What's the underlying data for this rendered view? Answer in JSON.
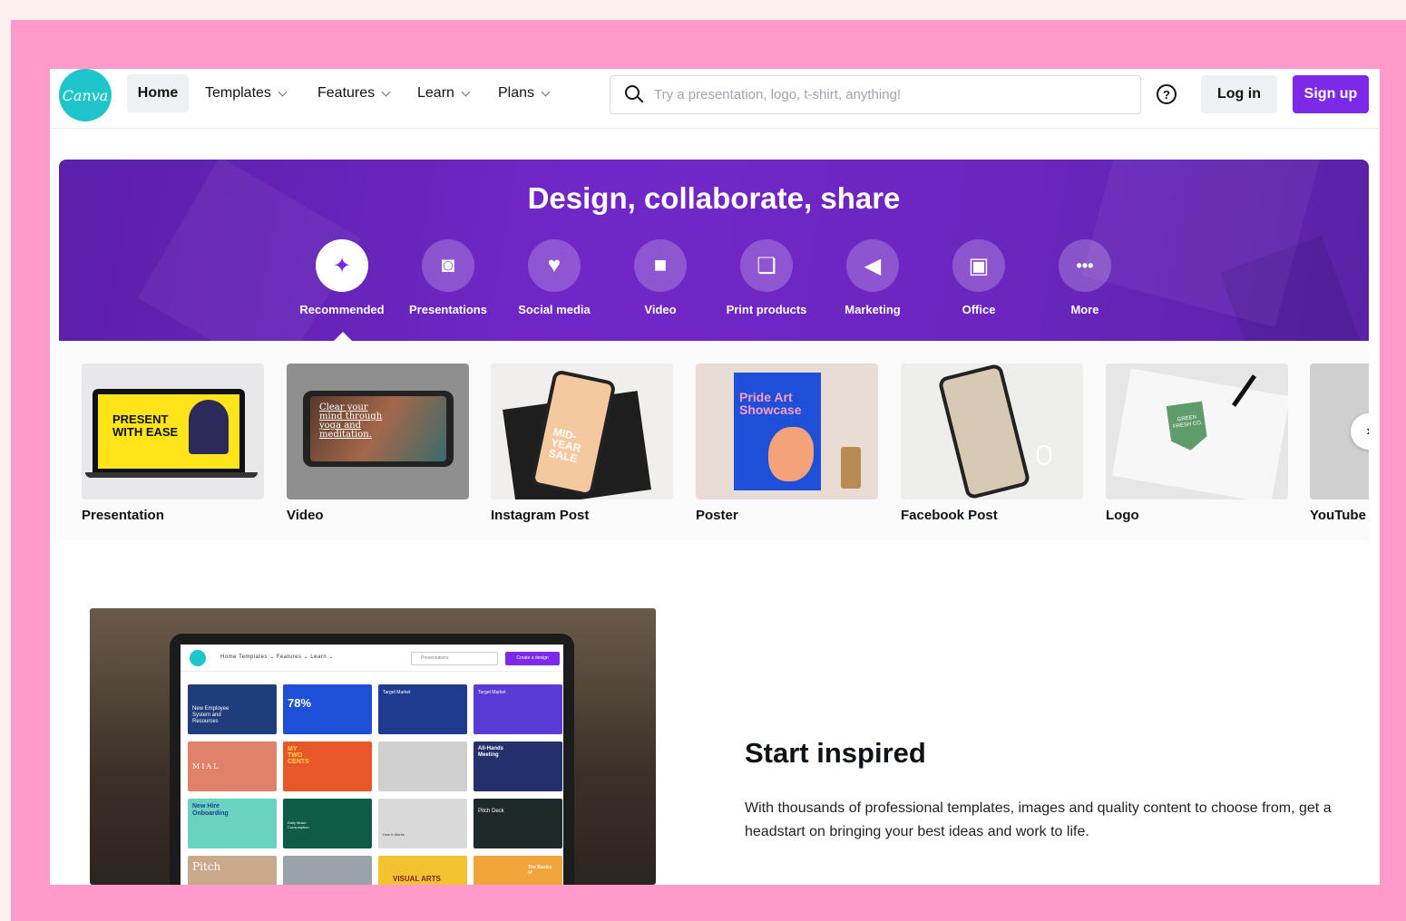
{
  "nav": {
    "logo_text": "Canva",
    "items": [
      {
        "label": "Home"
      },
      {
        "label": "Templates"
      },
      {
        "label": "Features"
      },
      {
        "label": "Learn"
      },
      {
        "label": "Plans"
      }
    ],
    "search_placeholder": "Try a presentation, logo, t-shirt, anything!",
    "help_symbol": "?",
    "login_label": "Log in",
    "signup_label": "Sign up"
  },
  "hero": {
    "title": "Design, collaborate, share",
    "categories": [
      {
        "label": "Recommended",
        "icon": "sparkle-icon",
        "glyph": "✦",
        "active": true
      },
      {
        "label": "Presentations",
        "icon": "presentation-icon",
        "glyph": "◙",
        "active": false
      },
      {
        "label": "Social media",
        "icon": "heart-chat-icon",
        "glyph": "♥",
        "active": false
      },
      {
        "label": "Video",
        "icon": "video-camera-icon",
        "glyph": "■",
        "active": false
      },
      {
        "label": "Print products",
        "icon": "print-icon",
        "glyph": "❏",
        "active": false
      },
      {
        "label": "Marketing",
        "icon": "megaphone-icon",
        "glyph": "◀",
        "active": false
      },
      {
        "label": "Office",
        "icon": "briefcase-icon",
        "glyph": "▣",
        "active": false
      },
      {
        "label": "More",
        "icon": "more-icon",
        "glyph": "•••",
        "active": false
      }
    ]
  },
  "carousel": {
    "items": [
      {
        "label": "Presentation",
        "thumb_text": "PRESENT WITH EASE"
      },
      {
        "label": "Video",
        "thumb_text": "Clear your mind through yoga and meditation."
      },
      {
        "label": "Instagram Post",
        "thumb_text": "MID-YEAR SALE"
      },
      {
        "label": "Poster",
        "thumb_text": "Pride Art Showcase"
      },
      {
        "label": "Facebook Post"
      },
      {
        "label": "Logo",
        "thumb_text": "GREEN FRESH CO."
      },
      {
        "label": "YouTube"
      }
    ],
    "next_symbol": "›"
  },
  "feature": {
    "title": "Start inspired",
    "body": "With thousands of professional templates, images and quality content to choose from, get a headstart on bringing your best ideas and work to life.",
    "laptop_ui": {
      "nav_text": "Home    Templates ⌄    Features ⌄    Learn ⌄",
      "search_text": "Presentations",
      "button_text": "Create a design",
      "tiles": [
        "New Employee System and Resources",
        "78%",
        "Target Market",
        "Target Market",
        "MIAL",
        "MY TWO CENTS",
        "",
        "All-Hands Meeting",
        "New Hire Onboarding",
        "Daily Music Consumption",
        "How It Works",
        "Pitch Deck",
        "Pitch",
        "",
        "VISUAL ARTS",
        "The Basics of"
      ]
    }
  },
  "colors": {
    "brand_purple": "#7d2ae8",
    "logo_teal": "#20c4cb",
    "frame_pink": "#ff9acb"
  }
}
